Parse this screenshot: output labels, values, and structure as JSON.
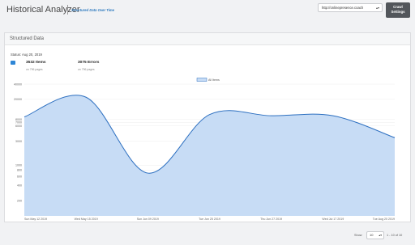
{
  "header": {
    "app_title": "Historical Analyzer",
    "subtitle": "Structured Data Over Time",
    "url_value": "http://onlinepresence.coach",
    "crawl_btn_line1": "Crawl",
    "crawl_btn_line2": "Settings"
  },
  "panel": {
    "title": "Structured Data",
    "status": "Status: Aug 20, 2019",
    "stats": [
      {
        "value": "3532 Items",
        "sub": "on 796 pages"
      },
      {
        "value": "3075 Errors",
        "sub": "on 796 pages"
      }
    ]
  },
  "chart_data": {
    "type": "area",
    "yscale": "log",
    "ylim": [
      100,
      40000
    ],
    "yticks": [
      "40000",
      "20000",
      "8000",
      "7000",
      "6000",
      "3000",
      "1000",
      "800",
      "600",
      "400",
      "200"
    ],
    "categories": [
      "Sun May 12 2019",
      "Wed May 15 2019",
      "Sun Jun 09 2019",
      "Tue Jun 25 2019",
      "Thu Jun 27 2019",
      "Wed Jul 17 2019",
      "Tue Aug 20 2019"
    ],
    "series": [
      {
        "name": "All Items",
        "values": [
          9000,
          22000,
          700,
          10000,
          9500,
          9500,
          3500
        ],
        "color": "#2c6fc0",
        "fill": "#c7dcf5"
      }
    ]
  },
  "footer": {
    "show_label": "Show",
    "page_size": "10",
    "range": "1 - 10 of 10"
  }
}
